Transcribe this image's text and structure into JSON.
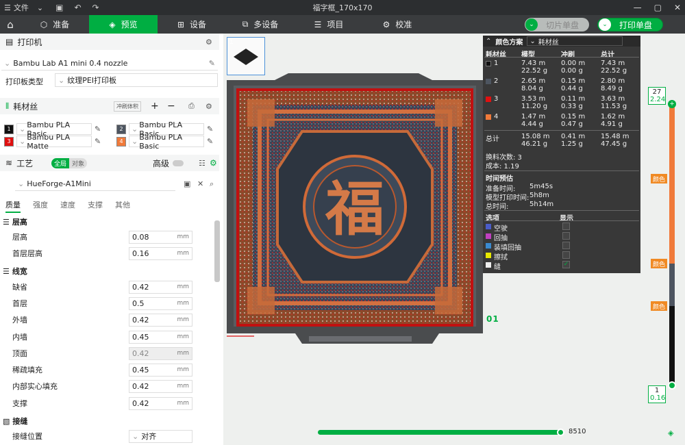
{
  "titlebar": {
    "menu_label": "文件",
    "title": "福字框_170x170"
  },
  "tabs": [
    {
      "label": "准备"
    },
    {
      "label": "预览"
    },
    {
      "label": "设备"
    },
    {
      "label": "多设备"
    },
    {
      "label": "项目"
    },
    {
      "label": "校准"
    }
  ],
  "actions": {
    "slice_label": "切片单盘",
    "print_label": "打印单盘"
  },
  "printer": {
    "section": "打印机",
    "name": "Bambu Lab A1 mini 0.4 nozzle",
    "plate_type_label": "打印板类型",
    "plate_type": "纹理PEI打印板"
  },
  "filament": {
    "section": "耗材丝",
    "flush_label": "冲刷体积",
    "items": [
      {
        "num": "1",
        "name": "Bambu PLA Basic",
        "color": "#111111"
      },
      {
        "num": "2",
        "name": "Bambu PLA Basic",
        "color": "#4d5560"
      },
      {
        "num": "3",
        "name": "Bambu PLA Matte",
        "color": "#e01010"
      },
      {
        "num": "4",
        "name": "Bambu PLA Basic",
        "color": "#f07a3a"
      }
    ]
  },
  "process": {
    "section": "工艺",
    "global_label": "全局",
    "object_label": "对象",
    "advanced_label": "高级",
    "preset": "HueForge-A1Mini"
  },
  "subtabs": [
    "质量",
    "强度",
    "速度",
    "支撑",
    "其他"
  ],
  "settings": {
    "layer_group": "层高",
    "layer_rows": [
      {
        "label": "层高",
        "value": "0.08",
        "unit": "mm"
      },
      {
        "label": "首层层高",
        "value": "0.16",
        "unit": "mm"
      }
    ],
    "width_group": "线宽",
    "width_rows": [
      {
        "label": "缺省",
        "value": "0.42",
        "unit": "mm"
      },
      {
        "label": "首层",
        "value": "0.5",
        "unit": "mm"
      },
      {
        "label": "外墙",
        "value": "0.42",
        "unit": "mm"
      },
      {
        "label": "内墙",
        "value": "0.45",
        "unit": "mm"
      },
      {
        "label": "顶面",
        "value": "0.42",
        "unit": "mm"
      },
      {
        "label": "稀疏填充",
        "value": "0.45",
        "unit": "mm"
      },
      {
        "label": "内部实心填充",
        "value": "0.42",
        "unit": "mm"
      },
      {
        "label": "支撑",
        "value": "0.42",
        "unit": "mm"
      }
    ],
    "seam_group": "接缝",
    "seam_label": "接缝位置",
    "seam_value": "对齐"
  },
  "plate": {
    "thumb_num": "1",
    "plate_char": "福",
    "plate_num": "01"
  },
  "stats": {
    "header_label": "颜色方案",
    "mode": "耗材丝",
    "cols": [
      "耗材丝",
      "模型",
      "冲刷",
      "总计"
    ],
    "rows": [
      {
        "id": "1",
        "color": "#111111",
        "m": [
          "7.43 m",
          "22.52 g"
        ],
        "f": [
          "0.00 m",
          "0.00 g"
        ],
        "t": [
          "7.43 m",
          "22.52 g"
        ]
      },
      {
        "id": "2",
        "color": "#4d5560",
        "m": [
          "2.65 m",
          "8.04 g"
        ],
        "f": [
          "0.15 m",
          "0.44 g"
        ],
        "t": [
          "2.80 m",
          "8.49 g"
        ]
      },
      {
        "id": "3",
        "color": "#e01010",
        "m": [
          "3.53 m",
          "11.20 g"
        ],
        "f": [
          "0.11 m",
          "0.33 g"
        ],
        "t": [
          "3.63 m",
          "11.53 g"
        ]
      },
      {
        "id": "4",
        "color": "#f07a3a",
        "m": [
          "1.47 m",
          "4.44 g"
        ],
        "f": [
          "0.15 m",
          "0.47 g"
        ],
        "t": [
          "1.62 m",
          "4.91 g"
        ]
      }
    ],
    "total_label": "总计",
    "total": {
      "m": [
        "15.08 m",
        "46.21 g"
      ],
      "f": [
        "0.41 m",
        "1.25 g"
      ],
      "t": [
        "15.48 m",
        "47.45 g"
      ]
    },
    "changes": "换料次数: 3",
    "cost": "成本: 1.19",
    "time_head": "时间预估",
    "prep_label": "准备时间:",
    "prep": "5m45s",
    "model_label": "模型打印时间:",
    "model": "5h8m",
    "total_time_label": "总时间:",
    "total_time": "5h14m",
    "opt_label": "选项",
    "show_label": "显示",
    "options": [
      {
        "label": "空驶",
        "color": "#4a5cc8"
      },
      {
        "label": "回抽",
        "color": "#c040c0"
      },
      {
        "label": "装填回抽",
        "color": "#3a8ad0"
      },
      {
        "label": "擦拭",
        "color": "#e8e800"
      },
      {
        "label": "缝",
        "color": "#eeeeee"
      }
    ]
  },
  "slider": {
    "top_layer": "27",
    "top_height": "2.24",
    "bottom_layer": "1",
    "bottom_height": "0.16",
    "color_tag": "颜色",
    "h_value": "8510"
  }
}
